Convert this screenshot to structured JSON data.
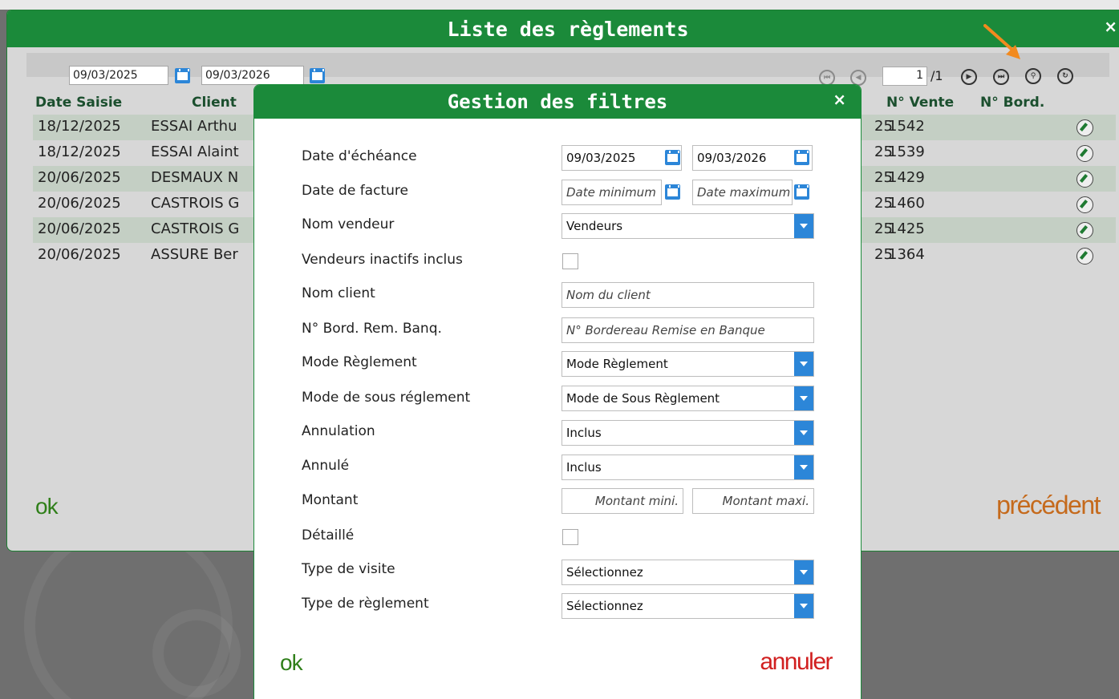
{
  "window": {
    "title": "Liste des règlements",
    "close_glyph": "×"
  },
  "toolbar": {
    "date_from": "09/03/2025",
    "date_to": "09/03/2026",
    "page_current": "1",
    "page_total": "/1",
    "icons": [
      "first-page-icon",
      "prev-page-icon",
      "next-page-icon",
      "last-page-icon",
      "search-filter-icon",
      "refresh-icon"
    ]
  },
  "table": {
    "headers": [
      "Date Saisie",
      "Client",
      "N° Vente",
      "N° Bord."
    ],
    "rows": [
      {
        "date": "18/12/2025",
        "client": "ESSAI Arthu",
        "year_suffix": "25",
        "vente": "1542"
      },
      {
        "date": "18/12/2025",
        "client": "ESSAI Alaint",
        "year_suffix": "25",
        "vente": "1539"
      },
      {
        "date": "20/06/2025",
        "client": "DESMAUX N",
        "year_suffix": "25",
        "vente": "1429"
      },
      {
        "date": "20/06/2025",
        "client": "CASTROIS G",
        "year_suffix": "25",
        "vente": "1460"
      },
      {
        "date": "20/06/2025",
        "client": "CASTROIS G",
        "year_suffix": "25",
        "vente": "1425"
      },
      {
        "date": "20/06/2025",
        "client": "ASSURE Ber",
        "year_suffix": "25",
        "vente": "1364"
      }
    ]
  },
  "main_footer": {
    "ok_label": "ok",
    "prev_label": "précédent"
  },
  "modal": {
    "title": "Gestion des filtres",
    "close_glyph": "×",
    "fields": {
      "date_echeance": {
        "label": "Date d'échéance",
        "from": "09/03/2025",
        "to": "09/03/2026"
      },
      "date_facture": {
        "label": "Date de facture",
        "from_placeholder": "Date minimum",
        "to_placeholder": "Date maximum"
      },
      "nom_vendeur": {
        "label": "Nom vendeur",
        "value": "Vendeurs"
      },
      "vendeurs_inactifs": {
        "label": "Vendeurs inactifs inclus",
        "checked": false
      },
      "nom_client": {
        "label": "Nom client",
        "placeholder": "Nom du client"
      },
      "bord_rem_banq": {
        "label": "N° Bord. Rem. Banq.",
        "placeholder": "N° Bordereau Remise en Banque"
      },
      "mode_reglement": {
        "label": "Mode Règlement",
        "value": "Mode Règlement"
      },
      "mode_sous_reglement": {
        "label": "Mode de sous réglement",
        "value": "Mode de Sous Règlement"
      },
      "annulation": {
        "label": "Annulation",
        "value": "Inclus"
      },
      "annule": {
        "label": "Annulé",
        "value": "Inclus"
      },
      "montant": {
        "label": "Montant",
        "min_placeholder": "Montant mini.",
        "max_placeholder": "Montant maxi."
      },
      "detaille": {
        "label": "Détaillé",
        "checked": false
      },
      "type_visite": {
        "label": "Type de visite",
        "value": "Sélectionnez"
      },
      "type_reglement": {
        "label": "Type de règlement",
        "value": "Sélectionnez"
      }
    },
    "ok_label": "ok",
    "cancel_label": "annuler"
  },
  "colors": {
    "header_green": "#1b8a3a",
    "accent_blue": "#2c86d8",
    "ok_green": "#2f7f19",
    "prev_orange": "#c56a1c",
    "cancel_red": "#d11f1f",
    "arrow_orange": "#f28a1e"
  }
}
